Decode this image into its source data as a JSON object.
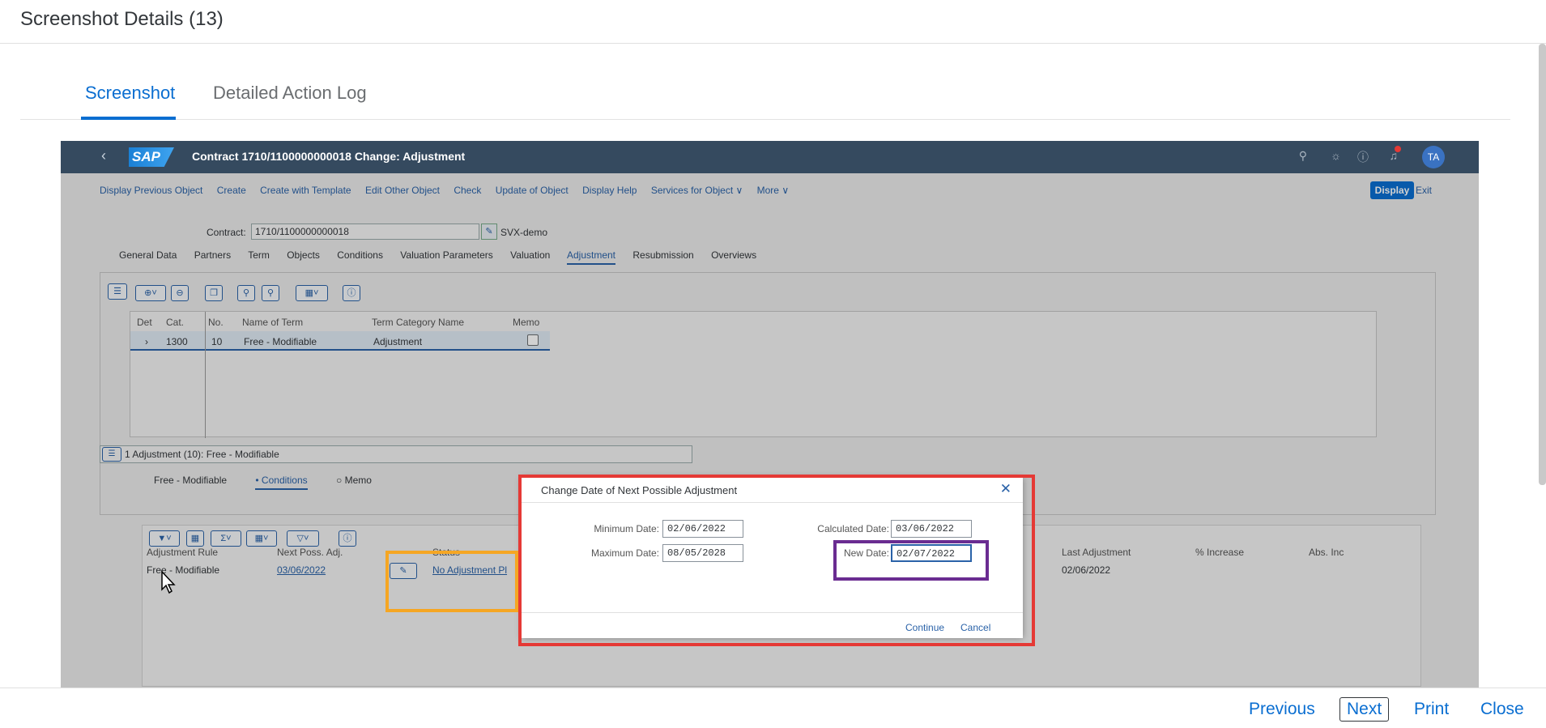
{
  "header": {
    "title": "Screenshot Details (13)"
  },
  "tabs": [
    {
      "label": "Screenshot",
      "active": true
    },
    {
      "label": "Detailed Action Log",
      "active": false
    }
  ],
  "sap": {
    "title": "Contract 1710/1100000000018 Change: Adjustment",
    "logo": "SAP",
    "avatar": "TA",
    "toolbar": [
      "Display Previous Object",
      "Create",
      "Create with Template",
      "Edit Other Object",
      "Check",
      "Update of Object",
      "Display Help",
      "Services for Object ∨",
      "More ∨"
    ],
    "display_btn": "Display",
    "exit_btn": "Exit",
    "contract_label": "Contract:",
    "contract_value": "1710/1100000000018",
    "contract_desc": "SVX-demo",
    "detail_tabs": [
      "General Data",
      "Partners",
      "Term",
      "Objects",
      "Conditions",
      "Valuation Parameters",
      "Valuation",
      "Adjustment",
      "Resubmission",
      "Overviews"
    ],
    "active_detail_tab": "Adjustment",
    "terms_table": {
      "headers": [
        "Det",
        "Cat.",
        "No.",
        "Name of Term",
        "Term Category Name",
        "Memo"
      ],
      "row": {
        "det": "›",
        "cat": "1300",
        "no": "10",
        "name": "Free - Modifiable",
        "category": "Adjustment"
      }
    },
    "adjustment_select": "1 Adjustment (10): Free - Modifiable",
    "subtabs": [
      "Free - Modifiable",
      "• Conditions",
      "○ Memo"
    ],
    "adj_table": {
      "headers": [
        "Adjustment Rule",
        "Next Poss. Adj.",
        "Status",
        "Last Adjustment",
        "% Increase",
        "Abs. Inc"
      ],
      "row": {
        "rule": "Free - Modifiable",
        "next": "03/06/2022",
        "status": "No Adjustment Pl",
        "last": "02/06/2022"
      }
    }
  },
  "dialog": {
    "title": "Change Date of Next Possible Adjustment",
    "min_label": "Minimum Date:",
    "min_value": "02/06/2022",
    "max_label": "Maximum Date:",
    "max_value": "08/05/2028",
    "calc_label": "Calculated Date:",
    "calc_value": "03/06/2022",
    "new_label": "New Date:",
    "new_value": "02/07/2022",
    "continue": "Continue",
    "cancel": "Cancel"
  },
  "footer": {
    "previous": "Previous",
    "next": "Next",
    "print": "Print",
    "close": "Close"
  },
  "colors": {
    "accent": "#0a6ed1",
    "shell": "#354a5f",
    "highlight_yellow": "#f5a623",
    "highlight_purple": "#6a2c91",
    "highlight_red": "#e53935"
  }
}
